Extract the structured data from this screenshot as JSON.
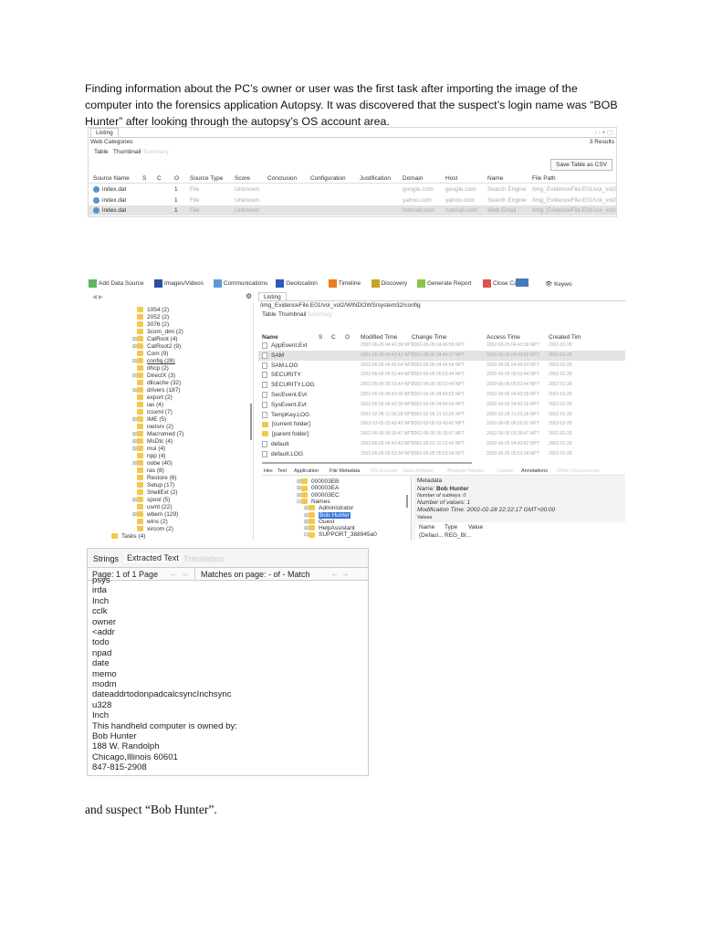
{
  "intro_text": "Finding information about the PC’s owner or user was the first task after importing the image of the computer into the forensics application Autopsy. It was discovered that the suspect’s login name was “BOB Hunter” after looking through the autopsy’s OS account area.",
  "closing_text": "and suspect “Bob Hunter”.",
  "shot1": {
    "tab": "Listing",
    "heading": "Web Categories",
    "results": "3 Results",
    "view_tabs": [
      "Table",
      "Thumbnail",
      "Summary"
    ],
    "save_button": "Save Table as CSV",
    "columns": [
      "Source Name",
      "S",
      "C",
      "O",
      "Source Type",
      "Score",
      "Conclusion",
      "Configuration",
      "Justification",
      "Domain",
      "Host",
      "Name",
      "File Path"
    ],
    "rows": [
      [
        "index.dat",
        "",
        "",
        "1",
        "File",
        "Unknown",
        "",
        "",
        "",
        "google.com",
        "google.com",
        "Search Engine",
        "/img_EvidenceFile.E01/vol_vol2/"
      ],
      [
        "index.dat",
        "",
        "",
        "1",
        "File",
        "Unknown",
        "",
        "",
        "",
        "yahoo.com",
        "yahoo.com",
        "Search Engine",
        "/img_EvidenceFile.E01/vol_vol2/"
      ],
      [
        "index.dat",
        "",
        "",
        "1",
        "File",
        "Unknown",
        "",
        "",
        "",
        "hotmail.com",
        "hotmail.com",
        "Web Email",
        "/img_EvidenceFile.E01/vol_vol2/"
      ]
    ]
  },
  "shot2": {
    "toolbar": [
      "Add Data Source",
      "Images/Videos",
      "Communications",
      "Geolocation",
      "Timeline",
      "Discovery",
      "Generate Report",
      "Close Case"
    ],
    "keyword": "Keywo",
    "tab": "Listing",
    "path": "/img_EvidenceFile.E01/vol_vol2/WINDOWS/system32/config",
    "view_tabs": [
      "Table",
      "Thumbnail",
      "Summary"
    ],
    "tree": [
      "1054 (2)",
      "2052 (2)",
      "3076 (2)",
      "3com_dmi (2)",
      "CatRoot (4)",
      "CatRoot2 (9)",
      "Com (9)",
      "config (28)",
      "dhcp (2)",
      "DirectX (3)",
      "dllcache (32)",
      "drivers (187)",
      "export (2)",
      "ias (4)",
      "icsxml (7)",
      "IME (5)",
      "inetsrv (2)",
      "Macromed (7)",
      "MsDtc (4)",
      "mui (4)",
      "npp (4)",
      "oobe (40)",
      "ras (8)",
      "Restore (6)",
      "Setup (17)",
      "ShellExt (2)",
      "spool (5)",
      "usmt (22)",
      "wbem (129)",
      "wins (2)",
      "xircom (2)",
      "Tasks (4)"
    ],
    "columns": [
      "Name",
      "S",
      "C",
      "O",
      "Modified Time",
      "Change Time",
      "Access Time",
      "Created Tim"
    ],
    "rows": [
      [
        "AppEvent.Evt",
        "2002-06-05 04:43:39 NPT",
        "2002-06-05 04:46:56 NPT",
        "2002-06-05 04:43:39 NPT",
        "2002-02-28"
      ],
      [
        "SAM",
        "2002-06-05 04:43:42 NPT",
        "2002-06-05 04:44:17 NPT",
        "2002-06-05 04:43:42 NPT",
        "2002-02-28"
      ],
      [
        "SAM.LOG",
        "2002-06-05 04:46:54 NPT",
        "2002-06-05 04:46:54 NPT",
        "2002-06-05 04:46:54 NPT",
        "2002-02-28"
      ],
      [
        "SECURITY",
        "2002-06-05 05:53:44 NPT",
        "2002-06-05 05:53:44 NPT",
        "2002-06-05 05:53:44 NPT",
        "2002-02-28"
      ],
      [
        "SECURITY.LOG",
        "2002-06-05 05:53:44 NPT",
        "2002-06-05 05:53:44 NPT",
        "2002-06-05 05:53:44 NPT",
        "2002-02-28"
      ],
      [
        "SecEvent.Evt",
        "2002-06-05 04:43:39 NPT",
        "2002-06-05 04:46:53 NPT",
        "2002-06-05 04:43:39 NPT",
        "2002-02-28"
      ],
      [
        "SysEvent.Evt",
        "2002-06-05 04:43:39 NPT",
        "2002-06-05 04:46:54 NPT",
        "2002-06-05 04:43:39 NPT",
        "2002-02-28"
      ],
      [
        "TempKey.LOG",
        "2002-02-28 21:06:28 NPT",
        "2002-02-28 21:10:26 NPT",
        "2002-02-28 21:03:28 NPT",
        "2002-02-28"
      ],
      [
        "[current folder]",
        "2002-03-05 03:49:42 NPT",
        "2002-03-05 03:49:42 NPT",
        "2002-06-05 06:25:01 NPT",
        "2002-02-28"
      ],
      [
        "[parent folder]",
        "2002-06-05 05:39:47 NPT",
        "2002-06-05 05:39:47 NPT",
        "2002-06-05 05:39:47 NPT",
        "2002-02-28"
      ],
      [
        "default",
        "2002-06-05 04:43:42 NPT",
        "2002-06-03 22:23:49 NPT",
        "2002-06-05 04:43:42 NPT",
        "2002-02-28"
      ],
      [
        "default.LOG",
        "2002-06-05 05:53:34 NPT",
        "2002-06-05 05:53:34 NPT",
        "2002-06-05 05:53:34 NPT",
        "2002-02-28"
      ]
    ],
    "bottom_tabs": [
      "Hex",
      "Text",
      "Application",
      "File Metadata",
      "OS Account",
      "Data Artifacts",
      "Analysis Results",
      "Context",
      "Annotations",
      "Other Occurrences"
    ],
    "reg_tree": [
      "000003EB",
      "000003EA",
      "000003EC",
      "Names",
      "Administrator",
      "Bob Hunter",
      "Guest",
      "HelpAssistant",
      "SUPPORT_388945a0"
    ],
    "metadata": {
      "title": "Metadata",
      "name_label": "Name:",
      "name_value": "Bob Hunter",
      "subkeys": "Number of subkeys: 0",
      "values_count": "Number of values: 1",
      "mod_time": "Modification Time: 2002-02-28 22:22:17 GMT+00:00",
      "values_title": "Values",
      "value_columns": [
        "Name",
        "Type",
        "Value"
      ],
      "value_row": [
        "(Defaul...",
        "REG_BI..."
      ]
    }
  },
  "shot3": {
    "tabs": [
      "Strings",
      "Extracted Text",
      "Translation"
    ],
    "page_label": "Page: 1 of 1 Page",
    "matches_label": "Matches on page: - of - Match",
    "lines": [
      "psys",
      "irda",
      "Inch",
      "cclk",
      "owner",
      "<addr",
      "todo",
      "npad",
      "date",
      "memo",
      "modm",
      "dateaddrtodonpadcalcsyncInchsync",
      "u328",
      "Inch",
      "This handheld computer is owned by:",
      "Bob Hunter",
      "188 W. Randolph",
      "Chicago,Illinois 60601",
      "847-815-2908"
    ]
  }
}
